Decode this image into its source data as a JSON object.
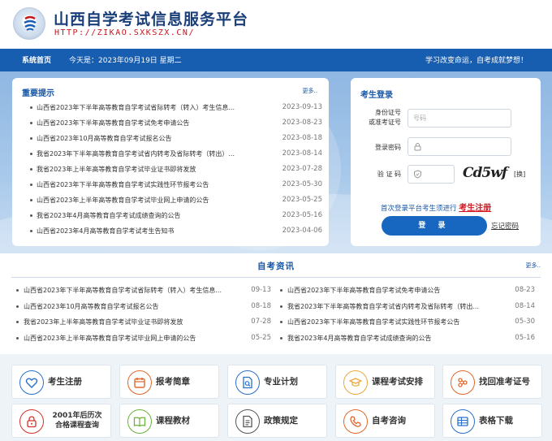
{
  "header": {
    "title": "山西自学考试信息服务平台",
    "url": "HTTP://ZIKAO.SXKSZX.CN/"
  },
  "navbar": {
    "home": "系统首页",
    "today": "今天是：2023年09月19日   星期二",
    "motto": "学习改变命运，自考成就梦想！"
  },
  "notice": {
    "title": "重要提示",
    "more": "更多..",
    "items": [
      {
        "text": "山西省2023年下半年高等教育自学考试省际转考（转入）考生信息...",
        "date": "2023-09-13"
      },
      {
        "text": "山西省2023年下半年高等教育自学考试免考申请公告",
        "date": "2023-08-23"
      },
      {
        "text": "山西省2023年10月高等教育自学考试报名公告",
        "date": "2023-08-18"
      },
      {
        "text": "我省2023年下半年高等教育自学考试省内转考及省际转考（转出）...",
        "date": "2023-08-14"
      },
      {
        "text": "我省2023年上半年高等教育自学考试毕业证书即将发放",
        "date": "2023-07-28"
      },
      {
        "text": "山西省2023年下半年高等教育自学考试实践性环节报考公告",
        "date": "2023-05-30"
      },
      {
        "text": "山西省2023年上半年高等教育自学考试毕业网上申请的公告",
        "date": "2023-05-25"
      },
      {
        "text": "我省2023年4月高等教育自学考试成绩查询的公告",
        "date": "2023-05-16"
      },
      {
        "text": "山西省2023年4月高等教育自学考试考生告知书",
        "date": "2023-04-06"
      }
    ]
  },
  "login": {
    "title": "考生登录",
    "id_label_1": "身份证号",
    "id_label_2": "或准考证号",
    "id_placeholder": "号码",
    "password_label": "登录密码",
    "captcha_label": "验 证 码",
    "captcha_text": "Cd5wf",
    "swap": "[换]",
    "register_hint": "首次登录平台考生须进行",
    "register_link": "考生注册",
    "login_button": "登  录",
    "forgot": "忘记密码"
  },
  "news": {
    "title": "自考资讯",
    "more": "更多..",
    "left": [
      {
        "text": "山西省2023年下半年高等教育自学考试省际转考（转入）考生信息...",
        "date": "09-13"
      },
      {
        "text": "山西省2023年10月高等教育自学考试报名公告",
        "date": "08-18"
      },
      {
        "text": "我省2023年上半年高等教育自学考试毕业证书即将发放",
        "date": "07-28"
      },
      {
        "text": "山西省2023年上半年高等教育自学考试毕业网上申请的公告",
        "date": "05-25"
      }
    ],
    "right": [
      {
        "text": "山西省2023年下半年高等教育自学考试免考申请公告",
        "date": "08-23"
      },
      {
        "text": "我省2023年下半年高等教育自学考试省内转考及省际转考（转出...",
        "date": "08-14"
      },
      {
        "text": "山西省2023年下半年高等教育自学考试实践性环节报考公告",
        "date": "05-30"
      },
      {
        "text": "我省2023年4月高等教育自学考试成绩查询的公告",
        "date": "05-16"
      }
    ]
  },
  "quick": [
    {
      "label": "考生注册",
      "icon": "heart-shield-icon",
      "color": "#2a6fc9"
    },
    {
      "label": "报考简章",
      "icon": "calendar-icon",
      "color": "#e0682a"
    },
    {
      "label": "专业计划",
      "icon": "document-search-icon",
      "color": "#2a6fc9"
    },
    {
      "label": "课程考试安排",
      "icon": "graduation-cap-icon",
      "color": "#e8a83a"
    },
    {
      "label": "找回准考证号",
      "icon": "find-icon",
      "color": "#e0682a"
    },
    {
      "label": "2001年后历次合格课程查询",
      "label_line1": "2001年后历次",
      "label_line2": "合格课程查询",
      "icon": "lock-icon",
      "color": "#d6302a"
    },
    {
      "label": "课程教材",
      "icon": "book-icon",
      "color": "#6bb23a"
    },
    {
      "label": "政策规定",
      "icon": "policy-doc-icon",
      "color": "#555555"
    },
    {
      "label": "自考咨询",
      "icon": "phone-icon",
      "color": "#e0682a"
    },
    {
      "label": "表格下载",
      "icon": "table-icon",
      "color": "#2a6fc9"
    }
  ]
}
